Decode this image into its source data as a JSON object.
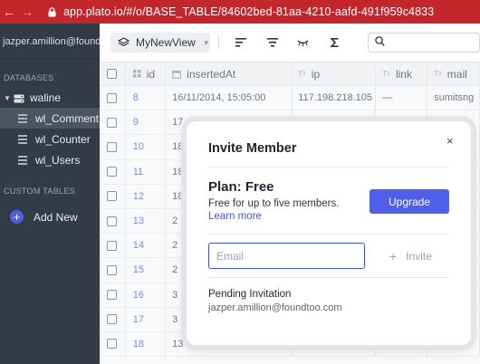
{
  "browser": {
    "back_glyph": "←",
    "forward_glyph": "→",
    "url": "app.plato.io/#/o/BASE_TABLE/84602bed-81aa-4210-aafd-491f959c4833"
  },
  "sidebar": {
    "user": "jazper.amillion@foundtoo",
    "databases_label": "DATABASES",
    "database": "waline",
    "tables": [
      "wl_Comment",
      "wl_Counter",
      "wl_Users"
    ],
    "custom_tables_label": "CUSTOM TABLES",
    "add_new": "Add New"
  },
  "toolbar": {
    "view_name": "MyNewView"
  },
  "table": {
    "columns": [
      "id",
      "insertedAt",
      "ip",
      "link",
      "mail"
    ],
    "rows": [
      {
        "id": "8",
        "insertedAt": "16/11/2014, 15:05:00",
        "ip": "117.198.218.105",
        "link": "—",
        "mail": "sumitsng"
      },
      {
        "id": "9",
        "insertedAt": "17",
        "ip": "",
        "link": "",
        "mail": ""
      },
      {
        "id": "10",
        "insertedAt": "18",
        "ip": "",
        "link": "",
        "mail": ""
      },
      {
        "id": "11",
        "insertedAt": "18",
        "ip": "",
        "link": "",
        "mail": ""
      },
      {
        "id": "12",
        "insertedAt": "18",
        "ip": "",
        "link": "",
        "mail": ""
      },
      {
        "id": "13",
        "insertedAt": "2",
        "ip": "",
        "link": "",
        "mail": ""
      },
      {
        "id": "14",
        "insertedAt": "2",
        "ip": "",
        "link": "",
        "mail": ""
      },
      {
        "id": "15",
        "insertedAt": "2",
        "ip": "",
        "link": "",
        "mail": ""
      },
      {
        "id": "16",
        "insertedAt": "3",
        "ip": "",
        "link": "",
        "mail": ""
      },
      {
        "id": "17",
        "insertedAt": "3",
        "ip": "",
        "link": "",
        "mail": ""
      },
      {
        "id": "18",
        "insertedAt": "13",
        "ip": "",
        "link": "",
        "mail": ""
      }
    ]
  },
  "modal": {
    "title": "Invite Member",
    "close_glyph": "×",
    "plan": "Plan: Free",
    "plan_desc": "Free for up to five members.",
    "learn_more": "Learn more",
    "upgrade": "Upgrade",
    "email_placeholder": "Email",
    "invite_glyph": "+",
    "invite": "Invite",
    "pending_label": "Pending Invitation",
    "pending_email": "jazper.amillion@foundtoo.com"
  },
  "colors": {
    "browser_bar": "#c3262b",
    "sidebar_bg": "#323c47",
    "accent": "#4f5fe8",
    "link": "#4155d8"
  }
}
